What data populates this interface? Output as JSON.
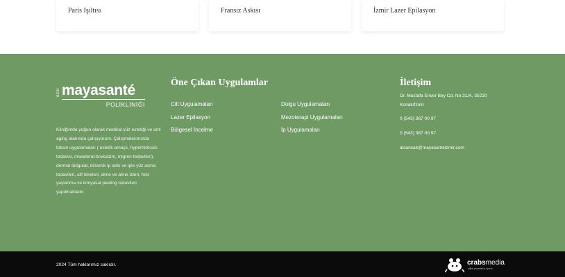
{
  "cards": [
    {
      "label": "Paris Işıltısı"
    },
    {
      "label": "Fransız Askısı"
    },
    {
      "label": "İzmir Lazer Epilasyon"
    }
  ],
  "footer": {
    "logo": {
      "ozel": "özel",
      "brand": "mayasanté",
      "sub": "POLİKLİNİĞİ"
    },
    "about": "Kliniğimde yoğun olarak medikal yüz estetiği ve anti aging alanında çalışıyorum. Çalışmalarımızda toksin uygulamaları ( estetik amaçlı, hyperhidrosis tedavisi, maseteral-bruksizim, migren tedavileri), dermal dolgular, dinamik ip askı ve iple yüz asma tedavileri, cilt lekeleri, akne ve akne izleri, foto yaşlanma ve kimyasal peeling tedavileri yapılmaktadır.",
    "apps_title": "Öne Çıkan Uygulamlar",
    "apps_col1": [
      "Cilt Uygulamaları",
      "Lazer Epilasyon",
      "Bölgesel İncelme"
    ],
    "apps_col2": [
      "Dolgu Uygulamaları",
      "Mezoterapi Uygulamaları",
      "İp Uygulamaları"
    ],
    "contact_title": "İletişim",
    "contact": {
      "address_line1": "Dr. Mustafa Enver Bey Cd. No:31/A, 35220",
      "address_line2": "Konak/İzmir",
      "phone1": "0 (543) 387 00 97",
      "phone2": "0 (543) 387 00 97",
      "email": "alsancak@mayasanteizmir.com"
    }
  },
  "bottom": {
    "copyright": "2024 Tüm haklarımız saklıdır.",
    "agency_bold": "crabs",
    "agency_rest": "media",
    "agency_tagline": "dijital pazarlama ajansı"
  },
  "colors": {
    "footer_bg": "#6f9a64",
    "bottom_bg": "#0b0b0b",
    "text": "#ffffff"
  }
}
